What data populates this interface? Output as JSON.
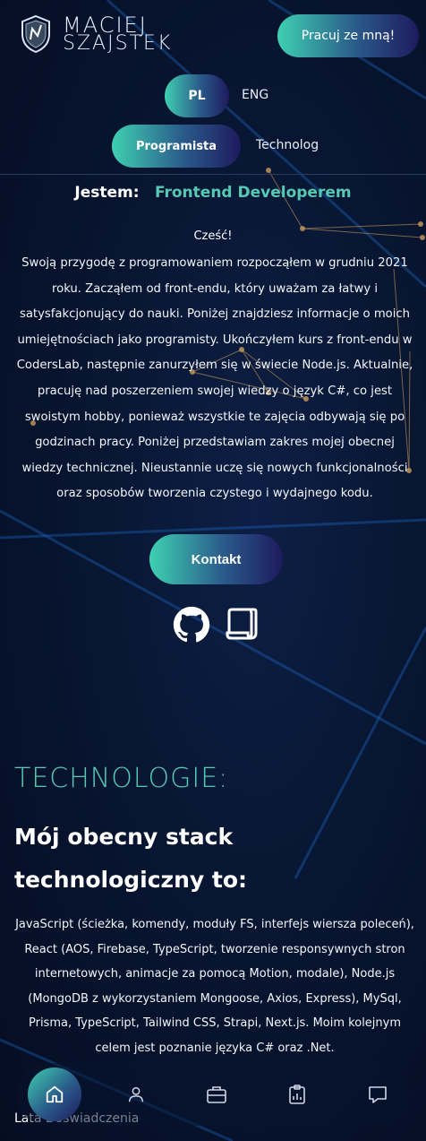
{
  "header": {
    "logo_line1": "MACIEJ",
    "logo_line2": "SZAJSTEK",
    "hire_button": "Pracuj ze mną!",
    "languages": [
      "PL",
      "ENG"
    ],
    "active_language": "PL",
    "roles": [
      "Programista",
      "Technolog"
    ],
    "active_role": "Programista"
  },
  "intro": {
    "label": "Jestem:",
    "role": "Frontend Developerem",
    "greeting": "Cześć!",
    "text": "Swoją przygodę z programowaniem rozpocząłem w grudniu 2021 roku. Zacząłem od front-endu, który uważam za łatwy i satysfakcjonujący do nauki. Poniżej znajdziesz informacje o moich umiejętnościach jako programisty. Ukończyłem kurs z front-endu w CodersLab, następnie zanurzyłem się w świecie Node.js. Aktualnie, pracuję nad poszerzeniem swojej wiedzy o język C#, co jest swoistym hobby, ponieważ wszystkie te zajęcia odbywają się po godzinach pracy. Poniżej przedstawiam zakres mojej obecnej wiedzy technicznej. Nieustannie uczę się nowych funkcjonalności oraz sposobów tworzenia czystego i wydajnego kodu.",
    "contact_button": "Kontakt",
    "icons": [
      "github-icon",
      "cv-scroll-icon"
    ]
  },
  "technologies": {
    "title": "TECHNOLOGIE:",
    "subtitle": "Mój obecny stack technologiczny to:",
    "description": "JavaScript (ścieżka, komendy, moduły FS, interfejs wiersza poleceń), React (AOS, Firebase, TypeScript, tworzenie responsywnych stron internetowych, animacje za pomocą Motion, modale), Node.js (MongoDB z wykorzystaniem Mongoose, Axios, Express), MySql, Prisma, TypeScript, Tailwind CSS, Strapi, Next.js. Moim kolejnym celem jest poznanie języka C# oraz .Net.",
    "experience_label": "Lata Doświadczenia"
  },
  "bottom_nav": {
    "items": [
      "home-icon",
      "user-icon",
      "briefcase-icon",
      "clipboard-chart-icon",
      "message-icon"
    ],
    "active": "home-icon"
  },
  "colors": {
    "accent": "#56c9b4",
    "gradient_start": "#3fd0b2",
    "gradient_end": "#1e1a5e",
    "background": "#081632"
  }
}
